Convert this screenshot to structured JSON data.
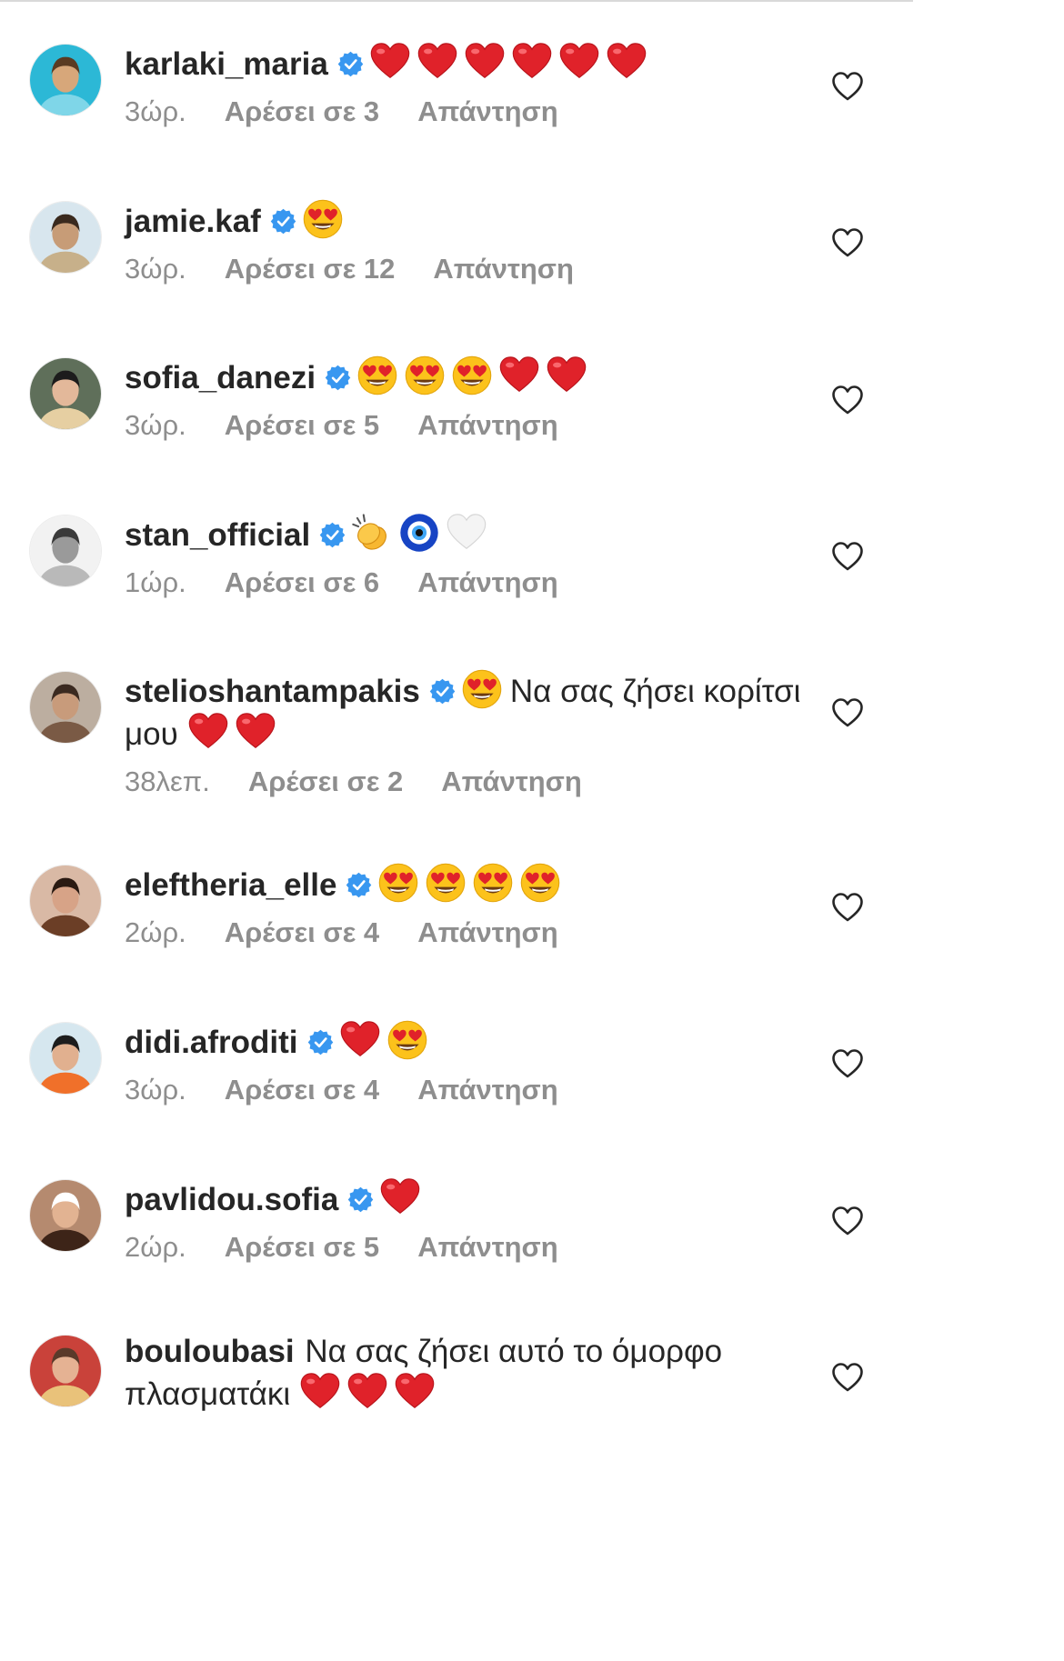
{
  "colors": {
    "verified": "#3897f0",
    "heart_red": "#e0222a",
    "meta_gray": "#8e8e8e",
    "text": "#262626"
  },
  "comments": [
    {
      "username": "karlaki_maria",
      "verified": true,
      "message": "",
      "emojis": [
        "red-heart",
        "red-heart",
        "red-heart",
        "red-heart",
        "red-heart",
        "red-heart"
      ],
      "time": "3ώρ.",
      "likes": "Αρέσει σε 3",
      "reply": "Απάντηση",
      "avatar_colors": [
        "#2cb8d6",
        "#7fd6e8",
        "#d7a77a",
        "#5a3b22"
      ]
    },
    {
      "username": "jamie.kaf",
      "verified": true,
      "message": "",
      "emojis": [
        "heart-eyes-face"
      ],
      "time": "3ώρ.",
      "likes": "Αρέσει σε 12",
      "reply": "Απάντηση",
      "avatar_colors": [
        "#d8e6ee",
        "#c7b08a",
        "#c79c77",
        "#3a2a1e"
      ]
    },
    {
      "username": "sofia_danezi",
      "verified": true,
      "message": "",
      "emojis": [
        "heart-eyes-face",
        "heart-eyes-face",
        "heart-eyes-face",
        "red-heart",
        "red-heart"
      ],
      "time": "3ώρ.",
      "likes": "Αρέσει σε 5",
      "reply": "Απάντηση",
      "avatar_colors": [
        "#5f6f5a",
        "#e6cfa2",
        "#e3b89a",
        "#1c1c1c"
      ]
    },
    {
      "username": "stan_official",
      "verified": true,
      "message": "",
      "emojis": [
        "clapping-hands",
        "nazar-amulet",
        "white-heart"
      ],
      "time": "1ώρ.",
      "likes": "Αρέσει σε 6",
      "reply": "Απάντηση",
      "avatar_colors": [
        "#f2f2f2",
        "#b9b9b9",
        "#9a9a9a",
        "#3a3a3a"
      ]
    },
    {
      "username": "stelioshantampakis",
      "verified": true,
      "message": "Να σας ζήσει κορίτσι μου",
      "emojis_before": [
        "heart-eyes-face"
      ],
      "emojis": [
        "red-heart",
        "red-heart"
      ],
      "time": "38λεπ.",
      "likes": "Αρέσει σε 2",
      "reply": "Απάντηση",
      "avatar_colors": [
        "#bcaea0",
        "#7a5a45",
        "#c89b7b",
        "#3b2a20"
      ]
    },
    {
      "username": "eleftheria_elle",
      "verified": true,
      "message": "",
      "emojis": [
        "heart-eyes-face",
        "heart-eyes-face",
        "heart-eyes-face",
        "heart-eyes-face"
      ],
      "time": "2ώρ.",
      "likes": "Αρέσει σε 4",
      "reply": "Απάντηση",
      "avatar_colors": [
        "#d9b9a5",
        "#6b3e26",
        "#d7a387",
        "#2a1a12"
      ]
    },
    {
      "username": "didi.afroditi",
      "verified": true,
      "message": "",
      "emojis": [
        "red-heart",
        "heart-eyes-face"
      ],
      "time": "3ώρ.",
      "likes": "Αρέσει σε 4",
      "reply": "Απάντηση",
      "avatar_colors": [
        "#d6e7ef",
        "#f0702a",
        "#e1b08f",
        "#1d1d1d"
      ]
    },
    {
      "username": "pavlidou.sofia",
      "verified": true,
      "message": "",
      "emojis": [
        "red-heart"
      ],
      "time": "2ώρ.",
      "likes": "Αρέσει σε 5",
      "reply": "Απάντηση",
      "avatar_colors": [
        "#b58a6f",
        "#3d2418",
        "#e2b392",
        "#ffffff"
      ]
    },
    {
      "username": "bouloubasi",
      "verified": false,
      "message": "Να σας ζήσει αυτό το όμορφο πλασματάκι",
      "emojis": [
        "red-heart",
        "red-heart",
        "red-heart"
      ],
      "time": "",
      "likes": "",
      "reply": "",
      "avatar_colors": [
        "#c9423a",
        "#e9c27a",
        "#e5b293",
        "#5a3a2a"
      ]
    }
  ]
}
